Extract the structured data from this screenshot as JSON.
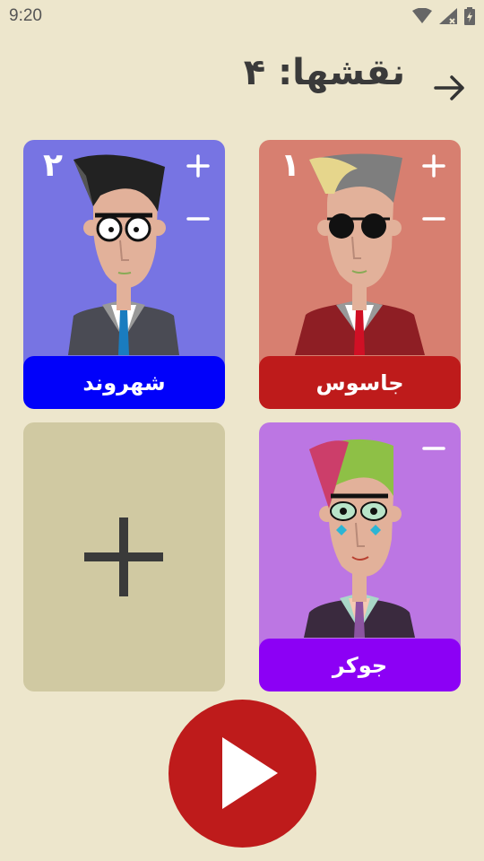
{
  "status_bar": {
    "time": "9:20"
  },
  "header": {
    "title": "نقشها: ۴"
  },
  "roles": [
    {
      "id": "spy",
      "name": "جاسوس",
      "count": "۱",
      "bg": "#D77F70",
      "label_bg": "#BE1B1B",
      "has_plus": true,
      "has_minus": true
    },
    {
      "id": "citizen",
      "name": "شهروند",
      "count": "۲",
      "bg": "#7774E3",
      "label_bg": "#0101FA",
      "has_plus": true,
      "has_minus": true
    },
    {
      "id": "joker",
      "name": "جوکر",
      "count": "",
      "bg": "#BC76E3",
      "label_bg": "#8C00F5",
      "has_plus": false,
      "has_minus": true
    }
  ],
  "colors": {
    "background": "#EDE6CC",
    "add_card": "#D0C9A2",
    "play_button": "#BE1B1B"
  },
  "icons": {
    "back": "arrow-right-icon",
    "add": "plus-icon",
    "play": "play-icon",
    "increase": "plus-icon",
    "decrease": "minus-icon"
  }
}
